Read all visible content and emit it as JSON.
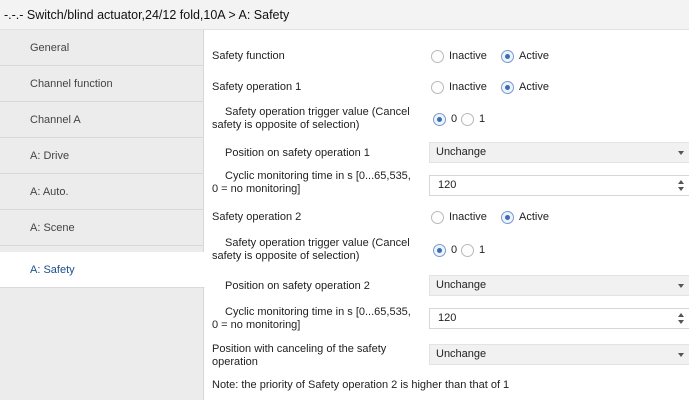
{
  "title": "-.-.- Switch/blind actuator,24/12 fold,10A > A: Safety",
  "sidebar": {
    "items": [
      {
        "label": "General"
      },
      {
        "label": "Channel function"
      },
      {
        "label": "Channel A"
      },
      {
        "label": "A: Drive"
      },
      {
        "label": "A: Auto."
      },
      {
        "label": "A: Scene"
      },
      {
        "label": "A: Safety",
        "active": true
      }
    ]
  },
  "params": {
    "safety_function": {
      "label": "Safety function",
      "opt1": "Inactive",
      "opt2": "Active",
      "selected": "Active"
    },
    "safety_op1": {
      "label": "Safety operation 1",
      "opt1": "Inactive",
      "opt2": "Active",
      "selected": "Active"
    },
    "trigger1": {
      "label_line1": "Safety operation trigger value (Cancel",
      "label_line2": "safety is opposite of  selection)",
      "opt1": "0",
      "opt2": "1",
      "selected": "0"
    },
    "position1": {
      "label": "Position on safety operation 1",
      "value": "Unchange"
    },
    "cyclic1": {
      "label_line1": "Cyclic monitoring time in s [0...65,535,",
      "label_line2": "0 = no monitoring]",
      "value": "120"
    },
    "safety_op2": {
      "label": "Safety operation 2",
      "opt1": "Inactive",
      "opt2": "Active",
      "selected": "Active"
    },
    "trigger2": {
      "label_line1": "Safety operation trigger value (Cancel",
      "label_line2": "safety is opposite of  selection)",
      "opt1": "0",
      "opt2": "1",
      "selected": "0"
    },
    "position2": {
      "label": "Position on safety operation 2",
      "value": "Unchange"
    },
    "cyclic2": {
      "label_line1": "Cyclic monitoring time in s [0...65,535,",
      "label_line2": "0 = no monitoring]",
      "value": "120"
    },
    "cancel_position": {
      "label_line1": "Position with canceling of the safety",
      "label_line2": "operation",
      "value": "Unchange"
    }
  },
  "note": "Note: the priority of Safety operation 2 is higher than that of 1"
}
